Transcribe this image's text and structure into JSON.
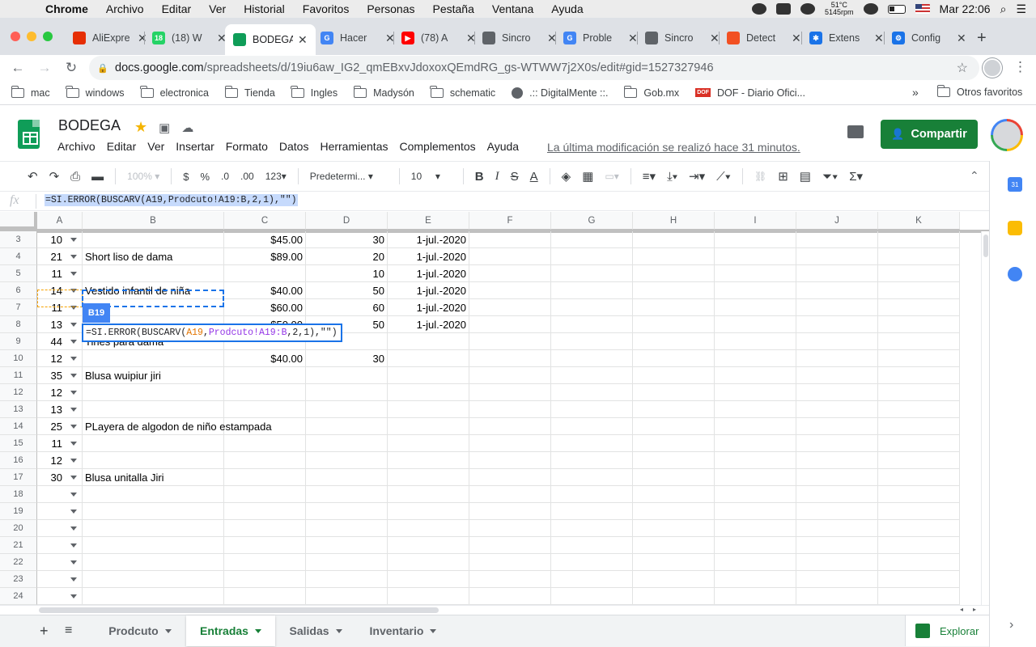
{
  "macos": {
    "apple": "",
    "app_name": "Chrome",
    "menu": [
      "Archivo",
      "Editar",
      "Ver",
      "Historial",
      "Favoritos",
      "Personas",
      "Pestaña",
      "Ventana",
      "Ayuda"
    ],
    "temp": "51°C",
    "rpm": "5145rpm",
    "clock": "Mar 22:06"
  },
  "browser": {
    "tabs": [
      {
        "title": "AliExpre",
        "fav_color": "#e62e04",
        "fav_text": ""
      },
      {
        "title": "(18) W",
        "fav_color": "#25d366",
        "fav_text": "18"
      },
      {
        "title": "BODEGA",
        "fav_color": "#0f9d58",
        "fav_text": ""
      },
      {
        "title": "Hacer",
        "fav_color": "#4285f4",
        "fav_text": "G"
      },
      {
        "title": "(78) A",
        "fav_color": "#ff0000",
        "fav_text": "▶"
      },
      {
        "title": "Sincro",
        "fav_color": "#5f6368",
        "fav_text": ""
      },
      {
        "title": "Proble",
        "fav_color": "#4285f4",
        "fav_text": "G"
      },
      {
        "title": "Sincro",
        "fav_color": "#5f6368",
        "fav_text": ""
      },
      {
        "title": "Detect",
        "fav_color": "#f25022",
        "fav_text": ""
      },
      {
        "title": "Extens",
        "fav_color": "#1a73e8",
        "fav_text": "✱"
      },
      {
        "title": "Config",
        "fav_color": "#1a73e8",
        "fav_text": "⚙"
      }
    ],
    "active_tab": 2,
    "url_host": "docs.google.com",
    "url_path": "/spreadsheets/d/19iu6aw_IG2_qmEBxvJdoxoxQEmdRG_gs-WTWW7j2X0s/edit#gid=1527327946",
    "bookmarks": [
      "mac",
      "windows",
      "electronica",
      "Tienda",
      "Ingles",
      "Madysón",
      "schematic",
      ".:: DigitalMente ::.",
      "Gob.mx",
      "DOF - Diario Ofici..."
    ],
    "bookmarks_more": "»",
    "other_bookmarks": "Otros favoritos"
  },
  "sheets": {
    "title": "BODEGA",
    "menus": [
      "Archivo",
      "Editar",
      "Ver",
      "Insertar",
      "Formato",
      "Datos",
      "Herramientas",
      "Complementos",
      "Ayuda"
    ],
    "last_modified": "La última modificación se realizó hace 31 minutos.",
    "share_label": "Compartir",
    "toolbar": {
      "zoom": "100%",
      "currency": "$",
      "percent": "%",
      "dec_less": ".0",
      "dec_more": ".00",
      "more_formats": "123",
      "font": "Predetermi...",
      "font_size": "10"
    },
    "formula": "=SI.ERROR(BUSCARV(A19,Prodcuto!A19:B,2,1),\"\")",
    "editor": {
      "pre": "=SI.ERROR(BUSCARV(",
      "ref": "A19",
      "comma1": ",",
      "range": "Prodcuto!A19:B",
      "post": ",2,1),\"\")"
    },
    "ref_tag": "B19",
    "columns": [
      "A",
      "B",
      "C",
      "D",
      "E",
      "F",
      "G",
      "H",
      "I",
      "J",
      "K"
    ],
    "rows": [
      {
        "n": "3",
        "a": "10",
        "b": "",
        "c": "$45.00",
        "d": "30",
        "e": "1-jul.-2020"
      },
      {
        "n": "4",
        "a": "21",
        "b": "Short liso de dama",
        "c": "$89.00",
        "d": "20",
        "e": "1-jul.-2020"
      },
      {
        "n": "5",
        "a": "11",
        "b": "",
        "c": "",
        "d": "10",
        "e": "1-jul.-2020"
      },
      {
        "n": "6",
        "a": "14",
        "b": "Vestido infantil de niña",
        "c": "$40.00",
        "d": "50",
        "e": "1-jul.-2020"
      },
      {
        "n": "7",
        "a": "11",
        "b": "",
        "c": "$60.00",
        "d": "60",
        "e": "1-jul.-2020"
      },
      {
        "n": "8",
        "a": "13",
        "b": "",
        "c": "$50.00",
        "d": "50",
        "e": "1-jul.-2020"
      },
      {
        "n": "9",
        "a": "44",
        "b": "Tines para dama",
        "c": "",
        "d": "",
        "e": ""
      },
      {
        "n": "10",
        "a": "12",
        "b": "",
        "c": "$40.00",
        "d": "30",
        "e": ""
      },
      {
        "n": "11",
        "a": "35",
        "b": "Blusa wuipiur jiri",
        "c": "",
        "d": "",
        "e": ""
      },
      {
        "n": "12",
        "a": "12",
        "b": "",
        "c": "",
        "d": "",
        "e": ""
      },
      {
        "n": "13",
        "a": "13",
        "b": "",
        "c": "",
        "d": "",
        "e": ""
      },
      {
        "n": "14",
        "a": "25",
        "b": "PLayera de algodon de niño estampada",
        "c": "",
        "d": "",
        "e": ""
      },
      {
        "n": "15",
        "a": "11",
        "b": "",
        "c": "",
        "d": "",
        "e": ""
      },
      {
        "n": "16",
        "a": "12",
        "b": "",
        "c": "",
        "d": "",
        "e": ""
      },
      {
        "n": "17",
        "a": "30",
        "b": "Blusa unitalla Jiri",
        "c": "",
        "d": "",
        "e": ""
      },
      {
        "n": "18",
        "a": "",
        "b": "",
        "c": "",
        "d": "",
        "e": ""
      },
      {
        "n": "19",
        "a": "",
        "b": "",
        "c": "",
        "d": "",
        "e": ""
      },
      {
        "n": "20",
        "a": "",
        "b": "",
        "c": "",
        "d": "",
        "e": ""
      },
      {
        "n": "21",
        "a": "",
        "b": "",
        "c": "",
        "d": "",
        "e": ""
      },
      {
        "n": "22",
        "a": "",
        "b": "",
        "c": "",
        "d": "",
        "e": ""
      },
      {
        "n": "23",
        "a": "",
        "b": "",
        "c": "",
        "d": "",
        "e": ""
      },
      {
        "n": "24",
        "a": "",
        "b": "",
        "c": "",
        "d": "",
        "e": ""
      }
    ],
    "sheet_tabs": [
      "Prodcuto",
      "Entradas",
      "Salidas",
      "Inventario"
    ],
    "active_sheet": 1,
    "explore_label": "Explorar",
    "calendar_badge": "31"
  }
}
